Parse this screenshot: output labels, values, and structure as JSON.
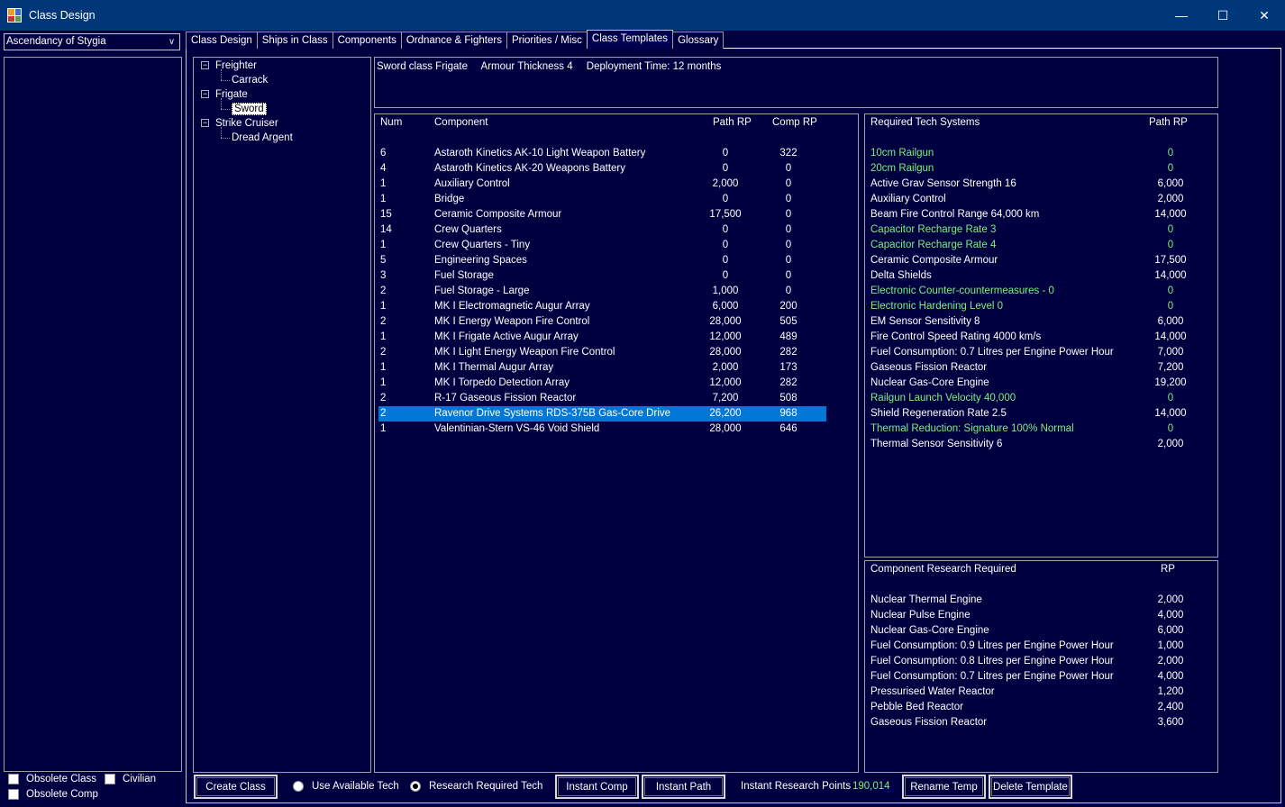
{
  "window": {
    "title": "Class Design",
    "minimize": "—",
    "maximize": "☐",
    "close": "✕"
  },
  "race_select": {
    "value": "Ascendancy of Stygia"
  },
  "tabs": [
    "Class Design",
    "Ships in Class",
    "Components",
    "Ordnance & Fighters",
    "Priorities / Misc",
    "Class Templates",
    "Glossary"
  ],
  "active_tab": "Class Templates",
  "tree": {
    "groups": [
      {
        "label": "Freighter",
        "children": [
          "Carrack"
        ]
      },
      {
        "label": "Frigate",
        "children": [
          "Sword"
        ]
      },
      {
        "label": "Strike Cruiser",
        "children": [
          "Dread Argent"
        ]
      }
    ],
    "selected": "Sword"
  },
  "summary": {
    "class_name": "Sword class Frigate",
    "armour": "Armour Thickness 4",
    "deployment": "Deployment Time: 12 months"
  },
  "components": {
    "headers": {
      "num": "Num",
      "component": "Component",
      "path_rp": "Path RP",
      "comp_rp": "Comp RP"
    },
    "rows": [
      {
        "num": "6",
        "component": "Astaroth Kinetics AK-10 Light Weapon Battery",
        "path_rp": "0",
        "comp_rp": "322"
      },
      {
        "num": "4",
        "component": "Astaroth Kinetics AK-20 Weapons Battery",
        "path_rp": "0",
        "comp_rp": "0"
      },
      {
        "num": "1",
        "component": "Auxiliary Control",
        "path_rp": "2,000",
        "comp_rp": "0"
      },
      {
        "num": "1",
        "component": "Bridge",
        "path_rp": "0",
        "comp_rp": "0"
      },
      {
        "num": "15",
        "component": "Ceramic Composite Armour",
        "path_rp": "17,500",
        "comp_rp": "0"
      },
      {
        "num": "14",
        "component": "Crew Quarters",
        "path_rp": "0",
        "comp_rp": "0"
      },
      {
        "num": "1",
        "component": "Crew Quarters - Tiny",
        "path_rp": "0",
        "comp_rp": "0"
      },
      {
        "num": "5",
        "component": "Engineering Spaces",
        "path_rp": "0",
        "comp_rp": "0"
      },
      {
        "num": "3",
        "component": "Fuel Storage",
        "path_rp": "0",
        "comp_rp": "0"
      },
      {
        "num": "2",
        "component": "Fuel Storage - Large",
        "path_rp": "1,000",
        "comp_rp": "0"
      },
      {
        "num": "1",
        "component": "MK I Electromagnetic Augur Array",
        "path_rp": "6,000",
        "comp_rp": "200"
      },
      {
        "num": "2",
        "component": "MK I Energy Weapon Fire Control",
        "path_rp": "28,000",
        "comp_rp": "505"
      },
      {
        "num": "1",
        "component": "MK I Frigate Active Augur Array",
        "path_rp": "12,000",
        "comp_rp": "489"
      },
      {
        "num": "2",
        "component": "MK I Light Energy Weapon Fire Control",
        "path_rp": "28,000",
        "comp_rp": "282"
      },
      {
        "num": "1",
        "component": "MK I Thermal Augur Array",
        "path_rp": "2,000",
        "comp_rp": "173"
      },
      {
        "num": "1",
        "component": "MK I Torpedo Detection Array",
        "path_rp": "12,000",
        "comp_rp": "282"
      },
      {
        "num": "2",
        "component": "R-17 Gaseous Fission Reactor",
        "path_rp": "7,200",
        "comp_rp": "508"
      },
      {
        "num": "2",
        "component": "Ravenor Drive Systems RDS-375B Gas-Core Drive",
        "path_rp": "26,200",
        "comp_rp": "968",
        "selected": true
      },
      {
        "num": "1",
        "component": "Valentinian-Stern VS-46 Void Shield",
        "path_rp": "28,000",
        "comp_rp": "646"
      }
    ]
  },
  "tech": {
    "headers": {
      "system": "Required Tech Systems",
      "path_rp": "Path RP"
    },
    "rows": [
      {
        "name": "10cm Railgun",
        "rp": "0",
        "done": true
      },
      {
        "name": "20cm Railgun",
        "rp": "0",
        "done": true
      },
      {
        "name": "Active Grav Sensor Strength 16",
        "rp": "6,000",
        "done": false
      },
      {
        "name": "Auxiliary Control",
        "rp": "2,000",
        "done": false
      },
      {
        "name": "Beam Fire Control Range 64,000 km",
        "rp": "14,000",
        "done": false
      },
      {
        "name": "Capacitor Recharge Rate 3",
        "rp": "0",
        "done": true
      },
      {
        "name": "Capacitor Recharge Rate 4",
        "rp": "0",
        "done": true
      },
      {
        "name": "Ceramic Composite Armour",
        "rp": "17,500",
        "done": false
      },
      {
        "name": "Delta Shields",
        "rp": "14,000",
        "done": false
      },
      {
        "name": "Electronic Counter-countermeasures - 0",
        "rp": "0",
        "done": true
      },
      {
        "name": "Electronic Hardening Level 0",
        "rp": "0",
        "done": true
      },
      {
        "name": "EM Sensor Sensitivity 8",
        "rp": "6,000",
        "done": false
      },
      {
        "name": "Fire Control Speed Rating 4000 km/s",
        "rp": "14,000",
        "done": false
      },
      {
        "name": "Fuel Consumption: 0.7 Litres per Engine Power Hour",
        "rp": "7,000",
        "done": false
      },
      {
        "name": "Gaseous Fission Reactor",
        "rp": "7,200",
        "done": false
      },
      {
        "name": "Nuclear Gas-Core Engine",
        "rp": "19,200",
        "done": false
      },
      {
        "name": "Railgun Launch Velocity 40,000",
        "rp": "0",
        "done": true
      },
      {
        "name": "Shield Regeneration Rate 2.5",
        "rp": "14,000",
        "done": false
      },
      {
        "name": "Thermal Reduction: Signature 100% Normal",
        "rp": "0",
        "done": true
      },
      {
        "name": "Thermal Sensor Sensitivity 6",
        "rp": "2,000",
        "done": false
      }
    ]
  },
  "research": {
    "headers": {
      "component": "Component Research Required",
      "rp": "RP"
    },
    "rows": [
      {
        "name": "Nuclear Thermal Engine",
        "rp": "2,000"
      },
      {
        "name": "Nuclear Pulse Engine",
        "rp": "4,000"
      },
      {
        "name": "Nuclear Gas-Core Engine",
        "rp": "6,000"
      },
      {
        "name": "Fuel Consumption: 0.9 Litres per Engine Power Hour",
        "rp": "1,000"
      },
      {
        "name": "Fuel Consumption: 0.8 Litres per Engine Power Hour",
        "rp": "2,000"
      },
      {
        "name": "Fuel Consumption: 0.7 Litres per Engine Power Hour",
        "rp": "4,000"
      },
      {
        "name": "Pressurised Water Reactor",
        "rp": "1,200"
      },
      {
        "name": "Pebble Bed Reactor",
        "rp": "2,400"
      },
      {
        "name": "Gaseous Fission Reactor",
        "rp": "3,600"
      }
    ]
  },
  "left_checks": {
    "obsolete_class": "Obsolete Class",
    "civilian": "Civilian",
    "obsolete_comp": "Obsolete Comp"
  },
  "bottom": {
    "create_class": "Create Class",
    "use_available_tech": "Use Available Tech",
    "research_required_tech": "Research Required Tech",
    "research_required_selected": true,
    "instant_comp": "Instant Comp",
    "instant_path": "Instant Path",
    "instant_research_label": "Instant Research Points",
    "instant_research_value": "190,014",
    "rename_temp": "Rename Temp",
    "delete_template": "Delete Template"
  },
  "colors": {
    "background": "#000040",
    "titlebar": "#00367a",
    "selection": "#0078d7",
    "researched_green": "#7cf07c"
  }
}
